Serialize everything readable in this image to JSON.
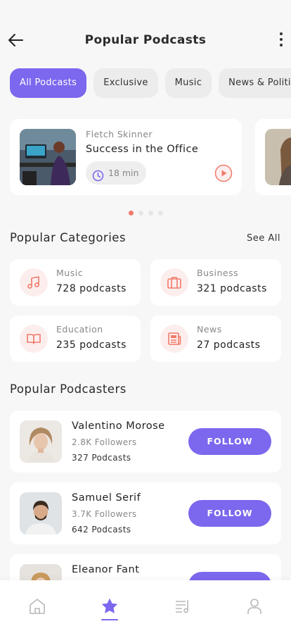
{
  "header": {
    "title": "Popular Podcasts"
  },
  "filters": [
    "All Podcasts",
    "Exclusive",
    "Music",
    "News & Politics"
  ],
  "featured": [
    {
      "author": "Fletch Skinner",
      "title": "Success in the Office",
      "duration": "18 min"
    }
  ],
  "carousel": {
    "pages": 4,
    "active_page": 1
  },
  "categories_section": {
    "title": "Popular Categories",
    "see_all": "See All"
  },
  "categories": [
    {
      "name": "Music",
      "count": "728 podcasts",
      "icon": "music-note-icon"
    },
    {
      "name": "Business",
      "count": "321 podcasts",
      "icon": "briefcase-icon"
    },
    {
      "name": "Education",
      "count": "235 podcasts",
      "icon": "book-icon"
    },
    {
      "name": "News",
      "count": "27 podcasts",
      "icon": "newspaper-icon"
    }
  ],
  "podcasters_section": {
    "title": "Popular Podcasters"
  },
  "podcasters": [
    {
      "name": "Valentino Morose",
      "followers": "2.8K Followers",
      "podcasts": "327 Podcasts",
      "follow_label": "FOLLOW"
    },
    {
      "name": "Samuel Serif",
      "followers": "3.7K Followers",
      "podcasts": "642 Podcasts",
      "follow_label": "FOLLOW"
    },
    {
      "name": "Eleanor Fant",
      "followers": "",
      "podcasts": "",
      "follow_label": "FOLLOW"
    }
  ],
  "bottom_nav": {
    "items": [
      "home-icon",
      "star-icon",
      "playlist-icon",
      "profile-icon"
    ],
    "active": "star-icon"
  },
  "colors": {
    "accent": "#7b68ee",
    "coral": "#f07a6a",
    "icon_bg": "#fdeeee",
    "background": "#f7f7f7"
  }
}
